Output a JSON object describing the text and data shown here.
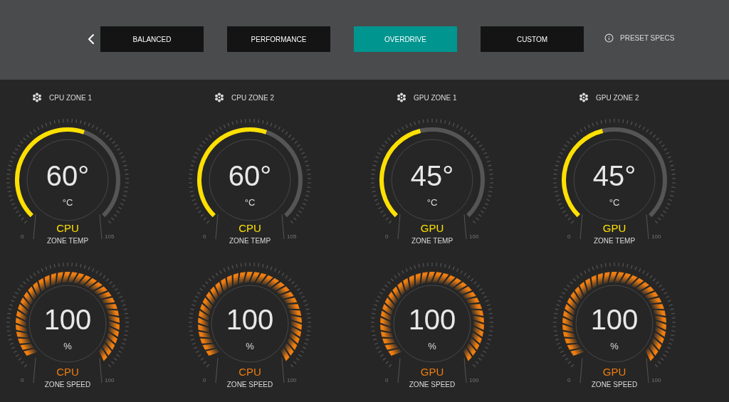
{
  "modes": [
    {
      "label": "BALANCED",
      "selected": false
    },
    {
      "label": "PERFORMANCE",
      "selected": false
    },
    {
      "label": "OVERDRIVE",
      "selected": true
    },
    {
      "label": "CUSTOM",
      "selected": false
    }
  ],
  "preset_specs": "PRESET SPECS",
  "zones": [
    {
      "title": "CPU ZONE 1",
      "gauges": [
        {
          "kind": "temp",
          "value": "60°",
          "unit": "°C",
          "source": "CPU",
          "caption": "ZONE TEMP",
          "min": "0",
          "max": "105"
        },
        {
          "kind": "speed",
          "value": "100",
          "unit": "%",
          "source": "CPU",
          "caption": "ZONE SPEED",
          "min": "0",
          "max": "100"
        }
      ]
    },
    {
      "title": "CPU ZONE 2",
      "gauges": [
        {
          "kind": "temp",
          "value": "60°",
          "unit": "°C",
          "source": "CPU",
          "caption": "ZONE TEMP",
          "min": "0",
          "max": "105"
        },
        {
          "kind": "speed",
          "value": "100",
          "unit": "%",
          "source": "CPU",
          "caption": "ZONE SPEED",
          "min": "0",
          "max": "100"
        }
      ]
    },
    {
      "title": "GPU ZONE 1",
      "gauges": [
        {
          "kind": "temp",
          "value": "45°",
          "unit": "°C",
          "source": "GPU",
          "caption": "ZONE TEMP",
          "min": "0",
          "max": "100"
        },
        {
          "kind": "speed",
          "value": "100",
          "unit": "%",
          "source": "GPU",
          "caption": "ZONE SPEED",
          "min": "0",
          "max": "100"
        }
      ]
    },
    {
      "title": "GPU ZONE 2",
      "gauges": [
        {
          "kind": "temp",
          "value": "45°",
          "unit": "°C",
          "source": "GPU",
          "caption": "ZONE TEMP",
          "min": "0",
          "max": "100"
        },
        {
          "kind": "speed",
          "value": "100",
          "unit": "%",
          "source": "GPU",
          "caption": "ZONE SPEED",
          "min": "0",
          "max": "100"
        }
      ]
    }
  ]
}
